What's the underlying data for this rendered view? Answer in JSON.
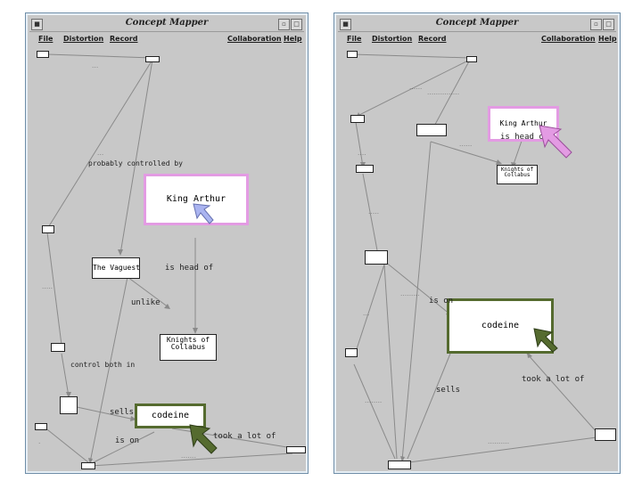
{
  "window_left": {
    "title": "Concept Mapper",
    "menu": [
      "File",
      "Distortion",
      "Record",
      "Collaboration",
      "Help"
    ],
    "nodes": {
      "king_arthur": "King Arthur",
      "the_vaguest": "The Vaguest",
      "knights": "Knights of Collabus",
      "codeine": "codeine"
    },
    "labels": {
      "probably_controlled_by": "probably controlled by",
      "is_head_of": "is head of",
      "unlike": "unlike",
      "control_both_in": "control both in",
      "sells": "sells",
      "is_on": "is on",
      "took_a_lot_of": "took a lot of"
    }
  },
  "window_right": {
    "title": "Concept Mapper",
    "menu": [
      "File",
      "Distortion",
      "Record",
      "Collaboration",
      "Help"
    ],
    "nodes": {
      "king_arthur": "King Arthur",
      "knights": "Knights of Collabus",
      "codeine": "codeine"
    },
    "labels": {
      "is_head_of": "is head of",
      "is_on": "is on",
      "took_a_lot_of": "took a lot of",
      "sells": "sells"
    }
  },
  "colors": {
    "focus_pink": "#e39be3",
    "focus_green": "#556b2f",
    "cursor_blue": "#aab4f0",
    "cursor_pink": "#e39be3",
    "cursor_green": "#556b2f"
  }
}
